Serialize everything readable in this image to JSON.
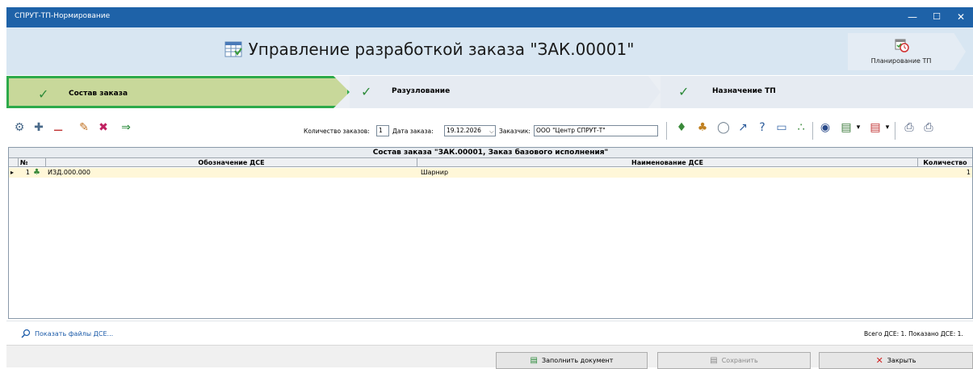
{
  "window": {
    "title": "СПРУТ-ТП-Нормирование",
    "controls": {
      "minimize": "—",
      "maximize": "☐",
      "close": "✕"
    }
  },
  "header": {
    "title": "Управление разработкой заказа \"ЗАК.00001\"",
    "title_icon": "table-icon",
    "plan_button_label": "Планирование ТП",
    "plan_button_icon": "calendar-clock-icon"
  },
  "steps": [
    {
      "label": "Состав заказа",
      "checked": true,
      "active": true
    },
    {
      "label": "Разузлование",
      "checked": true,
      "active": false
    },
    {
      "label": "Назначение ТП",
      "checked": true,
      "active": false
    }
  ],
  "toolbar": {
    "orders_count_label": "Количество заказов:",
    "orders_count_value": "1",
    "order_date_label": "Дата заказа:",
    "order_date_value": "19.12.2026",
    "customer_label": "Заказчик:",
    "customer_value": "ООО \"Центр СПРУТ-Т\""
  },
  "grid": {
    "caption": "Состав заказа \"ЗАК.00001, Заказ базового исполнения\"",
    "columns": [
      "№",
      "Обозначение ДСЕ",
      "Наименование ДСЕ",
      "Количество"
    ],
    "rows": [
      {
        "num": "1",
        "designation": "ИЗД.000.000",
        "name": "Шарнир",
        "qty": "1"
      }
    ]
  },
  "info": {
    "show_files_label": "Показать файлы ДСЕ...",
    "totals": "Всего ДСЕ: 1. Показано ДСЕ: 1."
  },
  "footer": {
    "fill_label": "Заполнить документ",
    "save_label": "Сохранить",
    "close_label": "Закрыть"
  },
  "colors": {
    "titlebar": "#1e62a8",
    "active_step": "#c8d89a",
    "active_step_border": "#2daa4a",
    "row_highlight": "#fff7d8"
  }
}
